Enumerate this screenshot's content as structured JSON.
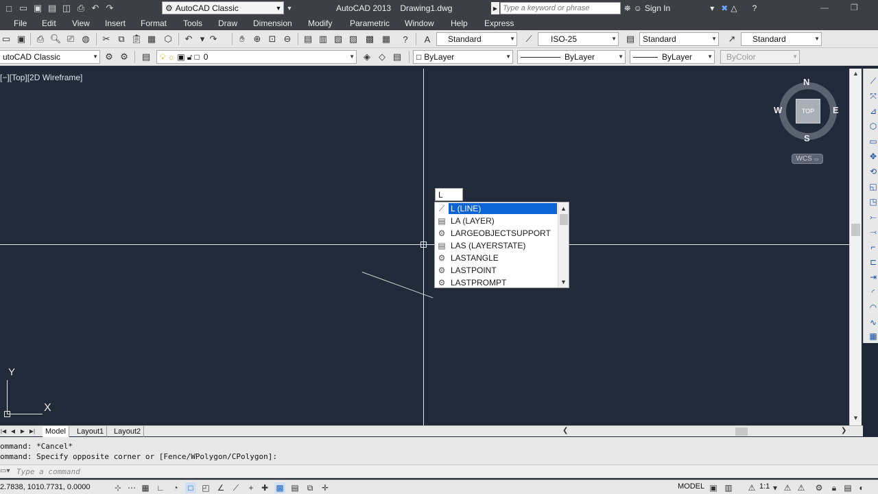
{
  "titlebar": {
    "workspace": "AutoCAD Classic",
    "app_title": "AutoCAD 2013    Drawing1.dwg",
    "search_placeholder": "Type a keyword or phrase",
    "signin": "Sign In"
  },
  "menu": [
    "File",
    "Edit",
    "View",
    "Insert",
    "Format",
    "Tools",
    "Draw",
    "Dimension",
    "Modify",
    "Parametric",
    "Window",
    "Help",
    "Express"
  ],
  "toolbar1": {
    "text_style": "Standard",
    "dim_style": "ISO-25",
    "table_style": "Standard",
    "multileader_style": "Standard"
  },
  "toolbar2": {
    "workspace": "utoCAD Classic",
    "layer": "0",
    "color": "ByLayer",
    "linetype": "ByLayer",
    "lineweight": "ByLayer",
    "plotstyle": "ByColor"
  },
  "viewport": {
    "label": "[−][Top][2D Wireframe]"
  },
  "viewcube": {
    "north": "N",
    "south": "S",
    "east": "E",
    "west": "W",
    "face": "TOP",
    "wcs": "WCS"
  },
  "ucs": {
    "x": "X",
    "y": "Y"
  },
  "dynamic_input": {
    "value": "L"
  },
  "autocomplete": {
    "items": [
      {
        "label": "L (LINE)",
        "icon": "line-icon",
        "selected": true
      },
      {
        "label": "LA (LAYER)",
        "icon": "layer-icon",
        "selected": false
      },
      {
        "label": "LARGEOBJECTSUPPORT",
        "icon": "gear-icon",
        "selected": false
      },
      {
        "label": "LAS (LAYERSTATE)",
        "icon": "layer-state-icon",
        "selected": false
      },
      {
        "label": "LASTANGLE",
        "icon": "gear-icon",
        "selected": false
      },
      {
        "label": "LASTPOINT",
        "icon": "gear-icon",
        "selected": false
      },
      {
        "label": "LASTPROMPT",
        "icon": "gear-icon",
        "selected": false
      }
    ]
  },
  "tabs": [
    "Model",
    "Layout1",
    "Layout2"
  ],
  "command": {
    "history": [
      "ommand: *Cancel*",
      "ommand: Specify opposite corner or [Fence/WPolygon/CPolygon]:"
    ],
    "placeholder": "Type a command"
  },
  "status": {
    "coords": "2.7838, 1010.7731, 0.0000",
    "model": "MODEL",
    "annotation_scale": "1:1"
  }
}
